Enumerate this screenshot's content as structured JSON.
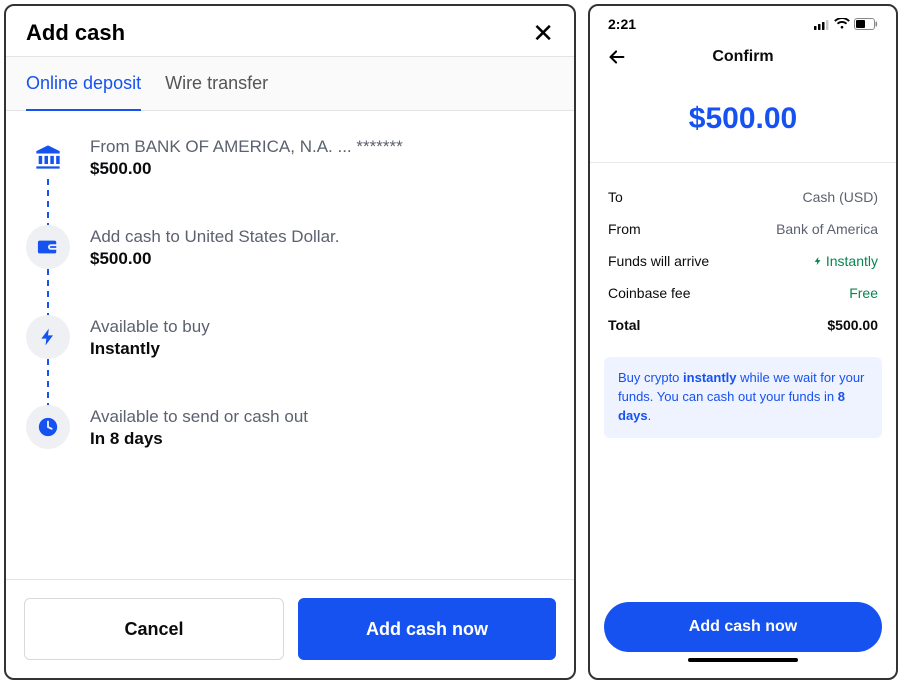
{
  "left": {
    "title": "Add cash",
    "tabs": {
      "online": "Online deposit",
      "wire": "Wire transfer"
    },
    "steps": {
      "from": {
        "label": "From BANK OF AMERICA, N.A. ... *******",
        "value": "$500.00"
      },
      "add": {
        "label": "Add cash to United States Dollar.",
        "value": "$500.00"
      },
      "buy": {
        "label": "Available to buy",
        "value": "Instantly"
      },
      "send": {
        "label": "Available to send or cash out",
        "value": "In 8 days"
      }
    },
    "buttons": {
      "cancel": "Cancel",
      "confirm": "Add cash now"
    }
  },
  "right": {
    "status_time": "2:21",
    "title": "Confirm",
    "amount": "$500.00",
    "details": {
      "to": {
        "key": "To",
        "value": "Cash (USD)"
      },
      "from": {
        "key": "From",
        "value": "Bank of America"
      },
      "arrive": {
        "key": "Funds will arrive",
        "value": "Instantly"
      },
      "fee": {
        "key": "Coinbase fee",
        "value": "Free"
      },
      "total": {
        "key": "Total",
        "value": "$500.00"
      }
    },
    "info_html": "Buy crypto <b>instantly</b> while we wait for your funds. You can cash out your funds in <b>8 days</b>.",
    "button": "Add cash now"
  }
}
